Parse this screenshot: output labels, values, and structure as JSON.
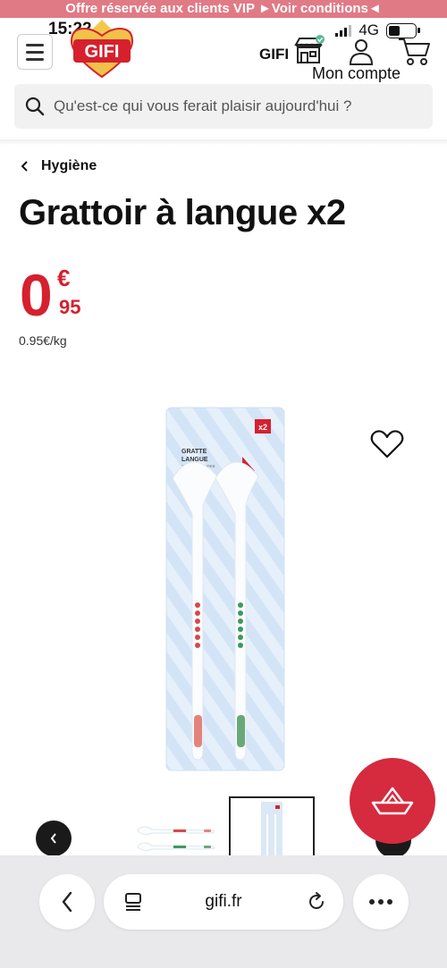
{
  "promo_banner": "Offre réservée aux clients VIP ►Voir conditions◄",
  "status": {
    "time": "15:22",
    "network": "4G"
  },
  "header": {
    "logo_text": "GIFI",
    "store_label": "GIFI",
    "account_label": "Mon compte"
  },
  "search": {
    "placeholder": "Qu'est-ce qui vous ferait plaisir aujourd'hui ?"
  },
  "breadcrumb": {
    "label": "Hygiène"
  },
  "product": {
    "title": "Grattoir à langue x2",
    "price_int": "0",
    "price_currency": "€",
    "price_dec": "95",
    "unit_price": "0.95€/kg",
    "pack_badge": "x2",
    "pack_line1": "GRATTE",
    "pack_line2": "LANGUE",
    "pack_line3": "TONGUE SCRAPER"
  },
  "browser": {
    "url": "gifi.fr"
  },
  "colors": {
    "brand_red": "#d6202e",
    "promo_bg": "#e07a85",
    "fab_red": "#d62a3e"
  }
}
